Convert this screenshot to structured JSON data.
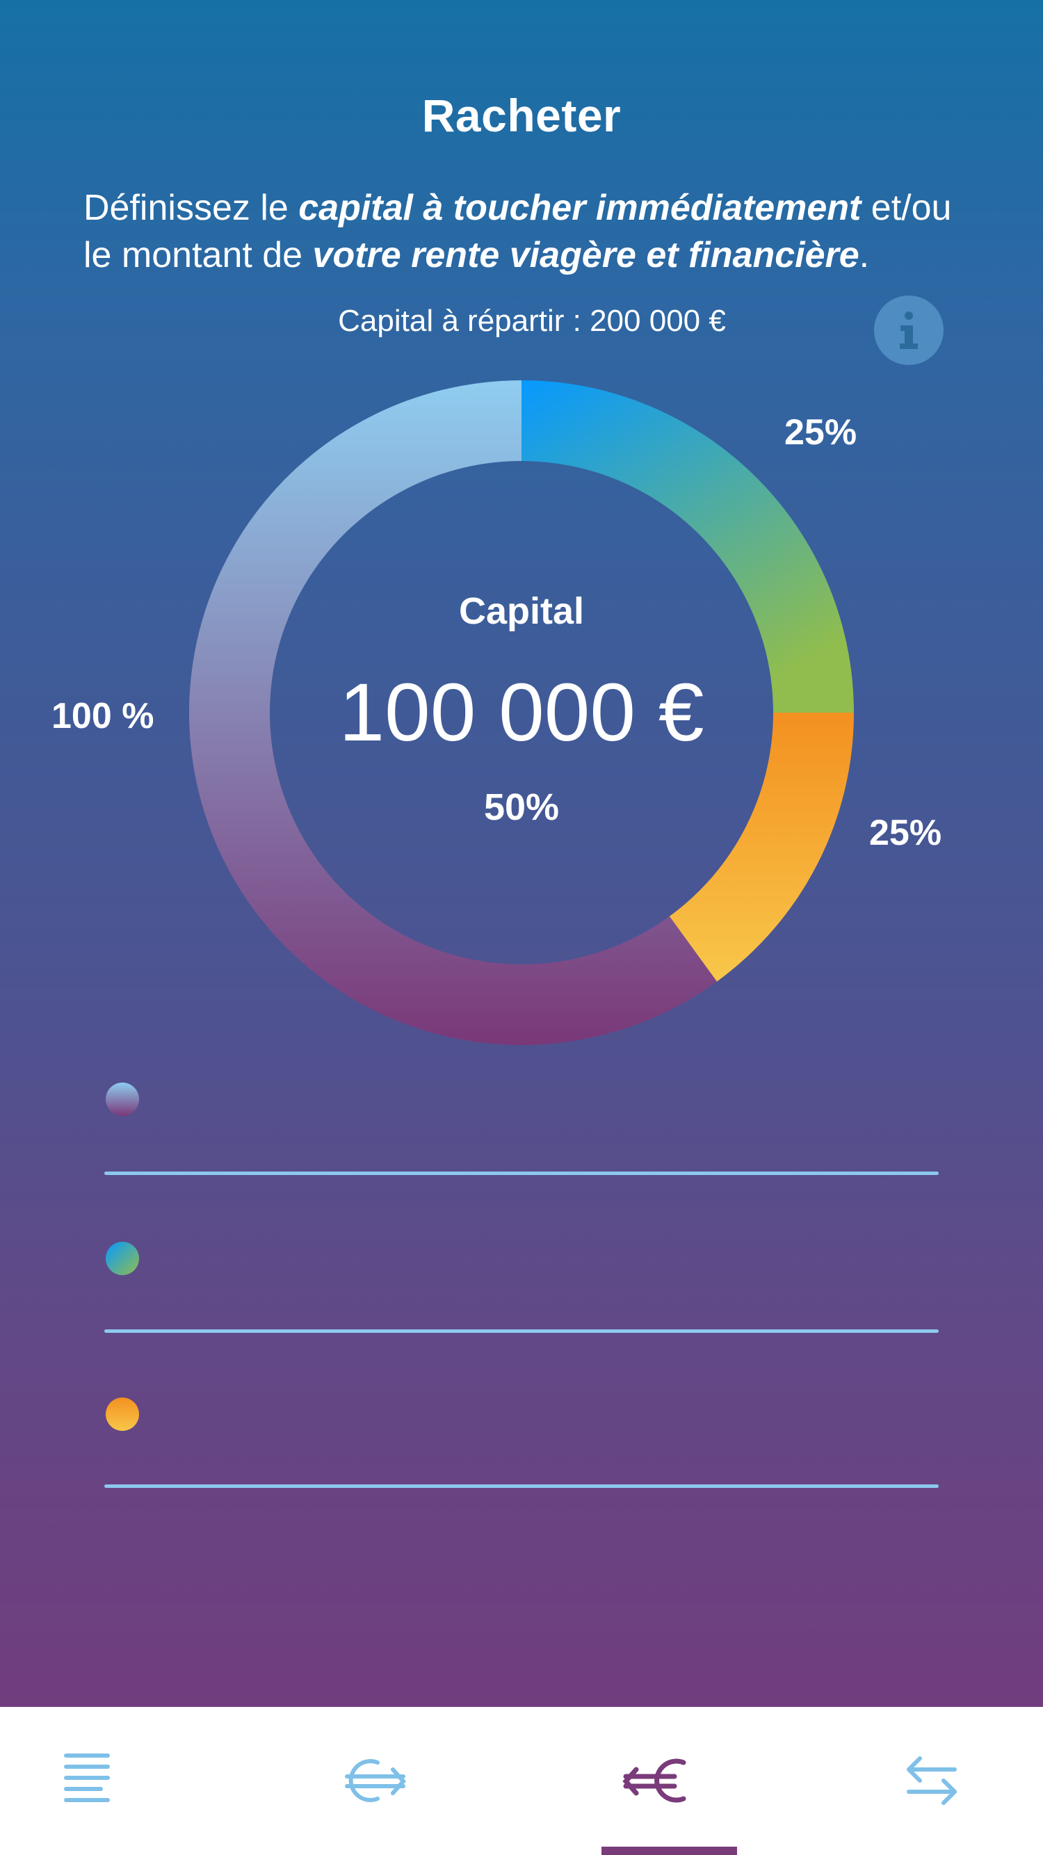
{
  "header": {
    "title": "Racheter"
  },
  "intro": {
    "part1": "Définissez le ",
    "bold1": "capital à toucher immédiatement",
    "part2": " et/ou le montant de ",
    "bold2": "votre rente viagère et financière",
    "part3": "."
  },
  "capital_total": "Capital à répartir : 200 000 €",
  "info_button": {
    "icon": "info-icon"
  },
  "donut": {
    "center_label": "Capital",
    "center_amount": "100 000 €",
    "center_percent": "50%",
    "segments": [
      {
        "key": "rente-viagere",
        "percent_label": "25%",
        "share": 0.25,
        "gradient": [
          "#0699ff",
          "#90bd4e"
        ]
      },
      {
        "key": "rente-financiere",
        "percent_label": "25%",
        "share": 0.15,
        "gradient": [
          "#f39020",
          "#f8c74a"
        ]
      },
      {
        "key": "capital",
        "percent_label": "100 %",
        "share": 0.6,
        "gradient": [
          "#8fcdf0",
          "#7a3878"
        ]
      }
    ]
  },
  "allocations": [
    {
      "key": "capital",
      "dot_gradient": [
        "#8fcdf0",
        "#7a3878"
      ]
    },
    {
      "key": "rente-viagere",
      "dot_gradient": [
        "#0699ff",
        "#90bd4e"
      ]
    },
    {
      "key": "rente-financiere",
      "dot_gradient": [
        "#f39020",
        "#f8c74a"
      ]
    }
  ],
  "tabbar": {
    "tabs": [
      {
        "icon": "menu-lines-icon",
        "active": false
      },
      {
        "icon": "euro-exchange-icon",
        "active": false
      },
      {
        "icon": "euro-back-icon",
        "active": true
      },
      {
        "icon": "swap-arrows-icon",
        "active": false
      }
    ],
    "active_color": "#7a3b7a",
    "inactive_color": "#7fc0e8"
  }
}
